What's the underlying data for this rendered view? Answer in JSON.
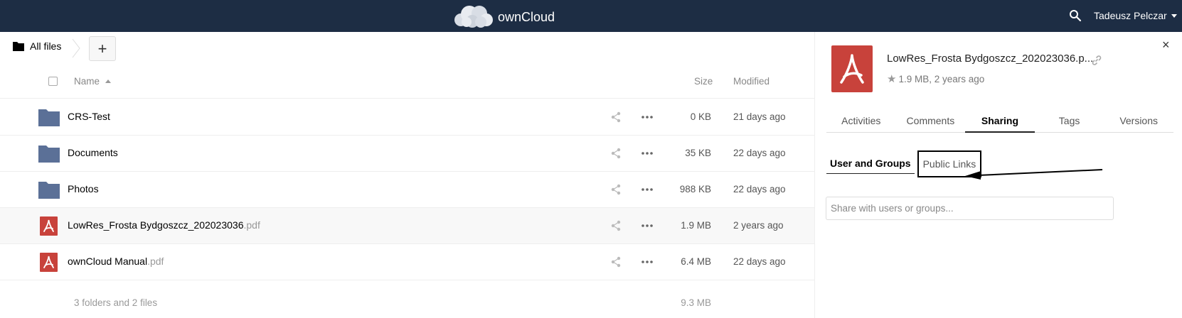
{
  "header": {
    "app_name": "ownCloud",
    "user_name": "Tadeusz Pelczar",
    "bg_color": "#1d2d44"
  },
  "breadcrumb": {
    "label": "All files"
  },
  "add_button": {
    "label": "+"
  },
  "table": {
    "columns": {
      "name": "Name",
      "size": "Size",
      "modified": "Modified"
    },
    "rows": [
      {
        "type": "folder",
        "name": "CRS-Test",
        "ext": "",
        "size": "0 KB",
        "modified": "21 days ago"
      },
      {
        "type": "folder",
        "name": "Documents",
        "ext": "",
        "size": "35 KB",
        "modified": "22 days ago"
      },
      {
        "type": "folder",
        "name": "Photos",
        "ext": "",
        "size": "988 KB",
        "modified": "22 days ago"
      },
      {
        "type": "pdf",
        "name": "LowRes_Frosta Bydgoszcz_202023036",
        "ext": ".pdf",
        "size": "1.9 MB",
        "modified": "2 years ago",
        "selected": true
      },
      {
        "type": "pdf",
        "name": "ownCloud Manual",
        "ext": ".pdf",
        "size": "6.4 MB",
        "modified": "22 days ago"
      }
    ],
    "summary": {
      "text": "3 folders and 2 files",
      "size": "9.3 MB"
    }
  },
  "sidebar": {
    "title": "LowRes_Frosta Bydgoszcz_202023036.p...",
    "meta": "1.9 MB, 2 years ago",
    "close_label": "×",
    "tabs": [
      "Activities",
      "Comments",
      "Sharing",
      "Tags",
      "Versions"
    ],
    "active_tab": "Sharing",
    "subtabs": {
      "users_groups": "User and Groups",
      "public_links": "Public Links"
    },
    "share_placeholder": "Share with users or groups..."
  },
  "colors": {
    "folder": "#5b7097",
    "pdf": "#c8423b",
    "accent": "#1d2d44"
  }
}
